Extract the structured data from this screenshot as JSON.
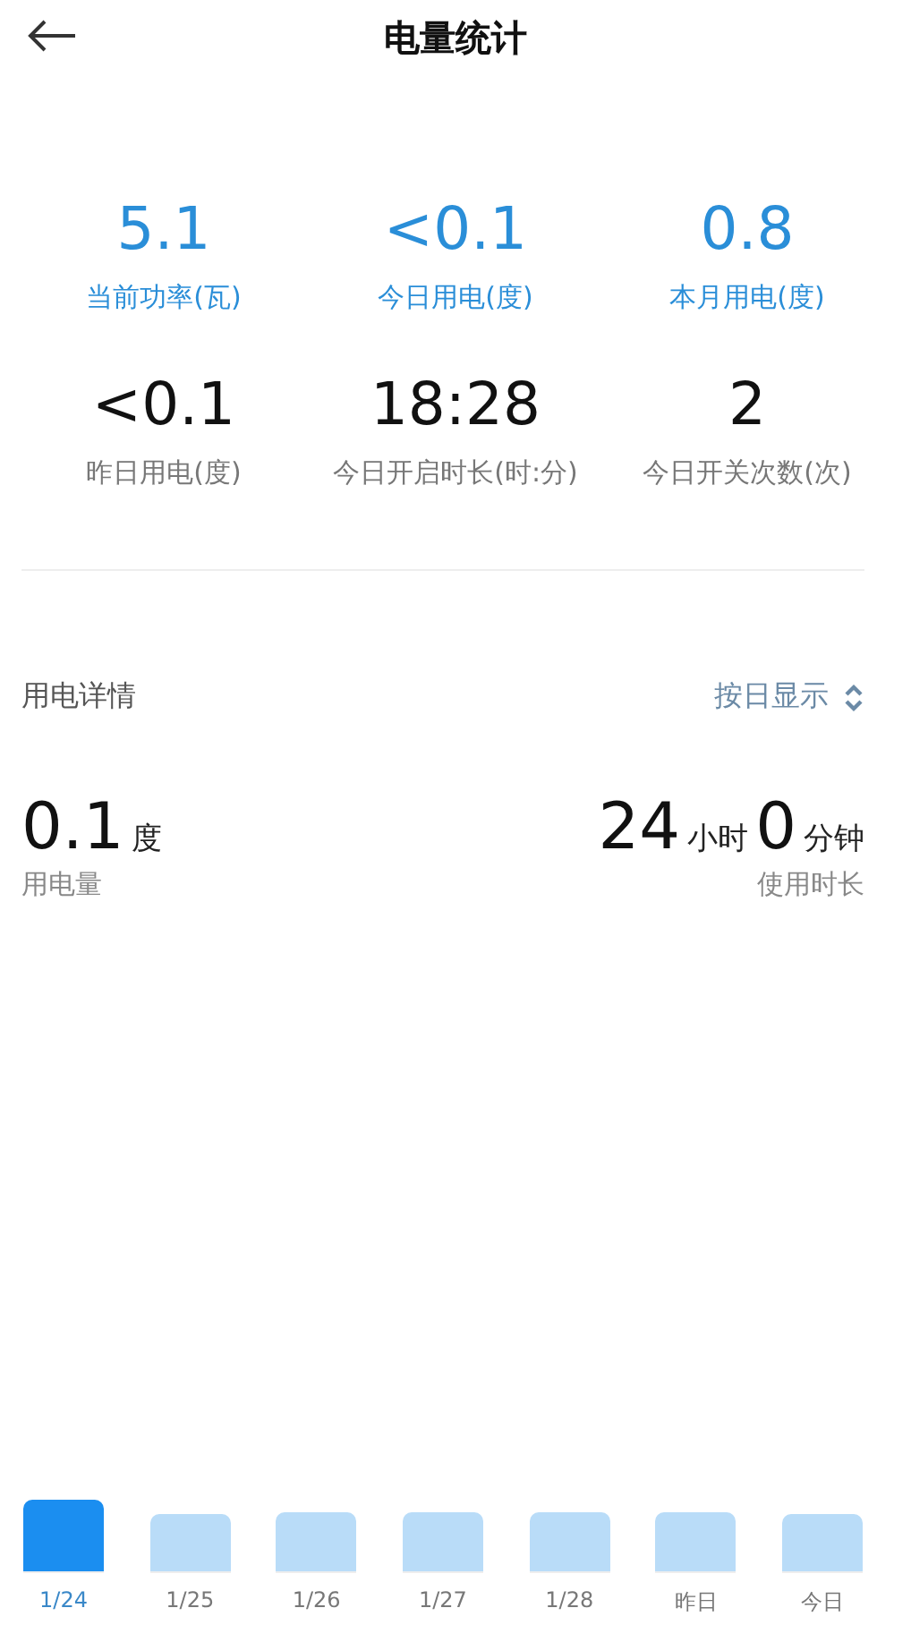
{
  "header": {
    "title": "电量统计"
  },
  "stats": [
    {
      "value": "5.1",
      "label": "当前功率(瓦)",
      "highlight": true
    },
    {
      "value": "<0.1",
      "label": "今日用电(度)",
      "highlight": true
    },
    {
      "value": "0.8",
      "label": "本月用电(度)",
      "highlight": true
    },
    {
      "value": "<0.1",
      "label": "昨日用电(度)",
      "highlight": false
    },
    {
      "value": "18:28",
      "label": "今日开启时长(时:分)",
      "highlight": false
    },
    {
      "value": "2",
      "label": "今日开关次数(次)",
      "highlight": false
    }
  ],
  "detail": {
    "title": "用电详情",
    "mode": "按日显示",
    "usage": {
      "value": "0.1",
      "unit": "度",
      "label": "用电量"
    },
    "duration": {
      "hours": "24",
      "hours_unit": "小时",
      "minutes": "0",
      "minutes_unit": "分钟",
      "label": "使用时长"
    }
  },
  "bars": [
    {
      "label": "1/24",
      "selected": true
    },
    {
      "label": "1/25",
      "selected": false
    },
    {
      "label": "1/26",
      "selected": false
    },
    {
      "label": "1/27",
      "selected": false
    },
    {
      "label": "1/28",
      "selected": false
    },
    {
      "label": "昨日",
      "selected": false
    },
    {
      "label": "今日",
      "selected": false
    }
  ]
}
